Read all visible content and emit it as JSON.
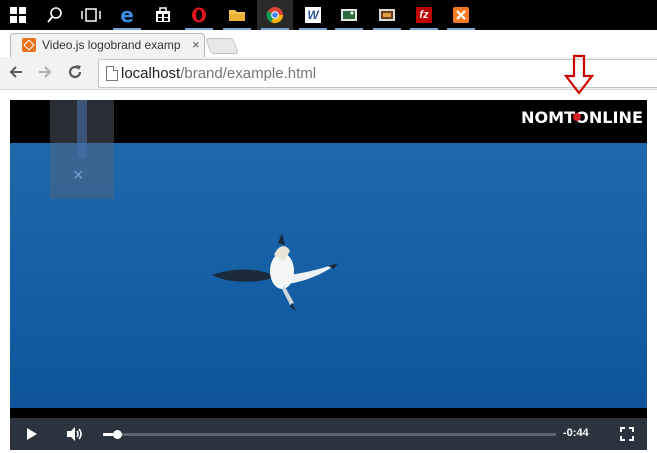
{
  "taskbar": {
    "items": [
      {
        "name": "windows-start"
      },
      {
        "name": "search"
      },
      {
        "name": "task-view"
      },
      {
        "name": "edge"
      },
      {
        "name": "store"
      },
      {
        "name": "opera"
      },
      {
        "name": "file-explorer"
      },
      {
        "name": "chrome"
      },
      {
        "name": "word"
      },
      {
        "name": "photos"
      },
      {
        "name": "media"
      },
      {
        "name": "filezilla"
      },
      {
        "name": "xampp"
      }
    ]
  },
  "browser": {
    "tab_title": "Video.js logobrand examp",
    "tab_close": "×",
    "url_host": "localhost",
    "url_path": "/brand/example.html"
  },
  "player": {
    "brand_text": "NOMTONLINE",
    "ghost_close": "×",
    "time_remaining": "-0:44",
    "progress_fraction": 0.03,
    "colors": {
      "control_bar": "#2b333f",
      "video_blue": "#155fa6"
    }
  },
  "annotation": {
    "arrow_color": "#cc0000"
  }
}
